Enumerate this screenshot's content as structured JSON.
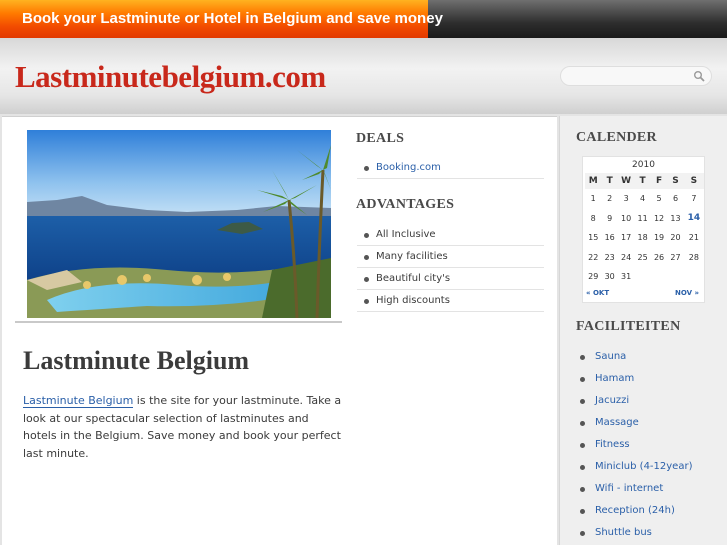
{
  "top_bar": {
    "tagline": "Book your Lastminute or Hotel in Belgium and save money"
  },
  "header": {
    "site_title": "Lastminutebelgium.com",
    "search_placeholder": ""
  },
  "main": {
    "post_title": "Lastminute Belgium",
    "body_link": "Lastminute Belgium",
    "body_text": " is the site for your lastminute. Take a look at our spectacular selection of lastminutes and hotels in the Belgium. Save money and book your perfect last minute."
  },
  "deals": {
    "title": "DEALS",
    "items": [
      {
        "label": "Booking.com"
      }
    ]
  },
  "advantages": {
    "title": "ADVANTAGES",
    "items": [
      {
        "label": "All Inclusive"
      },
      {
        "label": "Many facilities"
      },
      {
        "label": "Beautiful city's"
      },
      {
        "label": "High discounts"
      }
    ]
  },
  "calendar": {
    "title": "CALENDER",
    "year": "2010",
    "weekdays": [
      "M",
      "T",
      "W",
      "T",
      "F",
      "S",
      "S"
    ],
    "weeks": [
      [
        "1",
        "2",
        "3",
        "4",
        "5",
        "6",
        "7"
      ],
      [
        "8",
        "9",
        "10",
        "11",
        "12",
        "13",
        "14"
      ],
      [
        "15",
        "16",
        "17",
        "18",
        "19",
        "20",
        "21"
      ],
      [
        "22",
        "23",
        "24",
        "25",
        "26",
        "27",
        "28"
      ],
      [
        "29",
        "30",
        "31",
        "",
        "",
        "",
        ""
      ]
    ],
    "today": "14",
    "prev_label": "« OKT",
    "next_label": "NOV »"
  },
  "faciliteiten": {
    "title": "FACILITEITEN",
    "items": [
      {
        "label": "Sauna"
      },
      {
        "label": "Hamam"
      },
      {
        "label": "Jacuzzi"
      },
      {
        "label": "Massage"
      },
      {
        "label": "Fitness"
      },
      {
        "label": "Miniclub (4-12year)"
      },
      {
        "label": "Wifi - internet"
      },
      {
        "label": "Reception (24h)"
      },
      {
        "label": "Shuttle bus"
      }
    ]
  },
  "colors": {
    "brand_red": "#c8281b",
    "link_blue": "#2a5fa8",
    "top_orange": "#f24b00"
  }
}
